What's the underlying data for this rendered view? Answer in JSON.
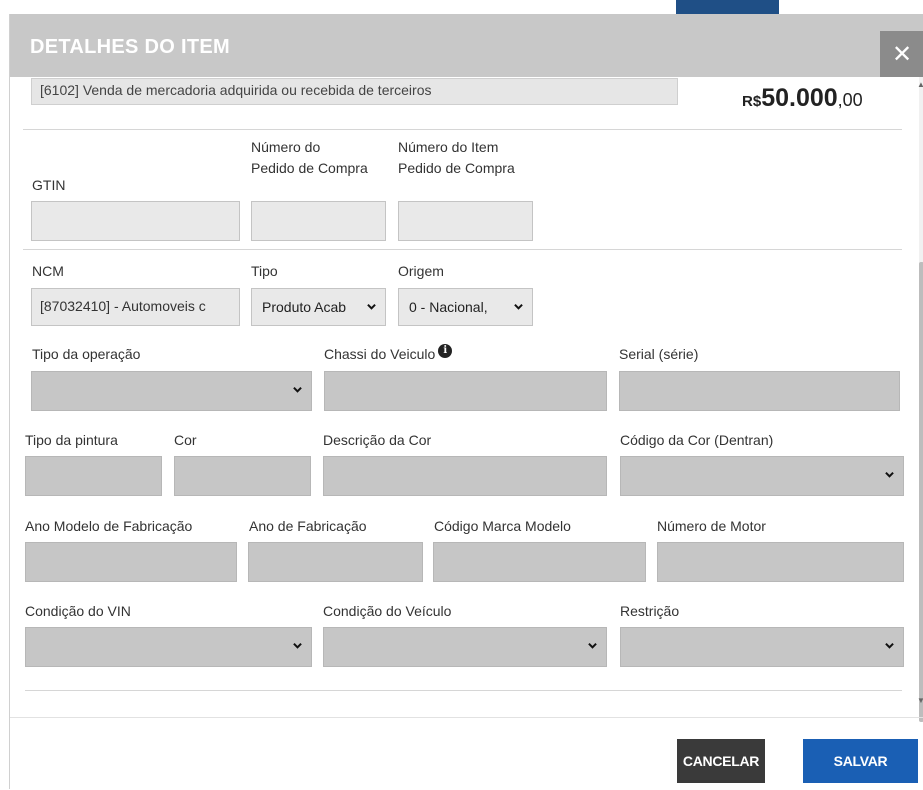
{
  "modal": {
    "title": "DETALHES DO ITEM",
    "close_glyph": "✕"
  },
  "cfop": {
    "value": "[6102] Venda de mercadoria adquirida ou recebida de terceiros"
  },
  "price": {
    "currency": "R$",
    "integer": "50.000",
    "decimals": ",00"
  },
  "fields": {
    "gtin": {
      "label": "GTIN",
      "value": ""
    },
    "pedido_compra": {
      "label_line1": "Número do",
      "label_line2": "Pedido de Compra",
      "value": ""
    },
    "item_pedido": {
      "label_line1": "Número do Item",
      "label_line2": "Pedido de Compra",
      "value": ""
    },
    "ncm": {
      "label": "NCM",
      "value": "[87032410] - Automoveis c"
    },
    "tipo": {
      "label": "Tipo",
      "value": "Produto Acab"
    },
    "origem": {
      "label": "Origem",
      "value": "0 - Nacional,"
    },
    "tipo_operacao": {
      "label": "Tipo da operação",
      "value": ""
    },
    "chassi": {
      "label": "Chassi do Veiculo",
      "value": "",
      "info_icon": "info-circle-icon"
    },
    "serial": {
      "label": "Serial (série)",
      "value": ""
    },
    "tipo_pintura": {
      "label": "Tipo da pintura",
      "value": ""
    },
    "cor": {
      "label": "Cor",
      "value": ""
    },
    "descricao_cor": {
      "label": "Descrição da Cor",
      "value": ""
    },
    "codigo_cor": {
      "label": "Código da Cor (Dentran)",
      "value": ""
    },
    "ano_modelo": {
      "label": "Ano Modelo de Fabricação",
      "value": ""
    },
    "ano_fabricacao": {
      "label": "Ano de Fabricação",
      "value": ""
    },
    "codigo_marca": {
      "label": "Código Marca Modelo",
      "value": ""
    },
    "numero_motor": {
      "label": "Número de Motor",
      "value": ""
    },
    "condicao_vin": {
      "label": "Condição do VIN",
      "value": ""
    },
    "condicao_veiculo": {
      "label": "Condição do Veículo",
      "value": ""
    },
    "restricao": {
      "label": "Restrição",
      "value": ""
    }
  },
  "footer": {
    "cancel_label": "CANCELAR",
    "save_label": "SALVAR"
  },
  "colors": {
    "header_bg": "#c8c8c8",
    "close_bg": "#8b8b8b",
    "field_bg": "#c6c6c6",
    "cancel_bg": "#3a3a3a",
    "save_bg": "#1a5fb4"
  }
}
